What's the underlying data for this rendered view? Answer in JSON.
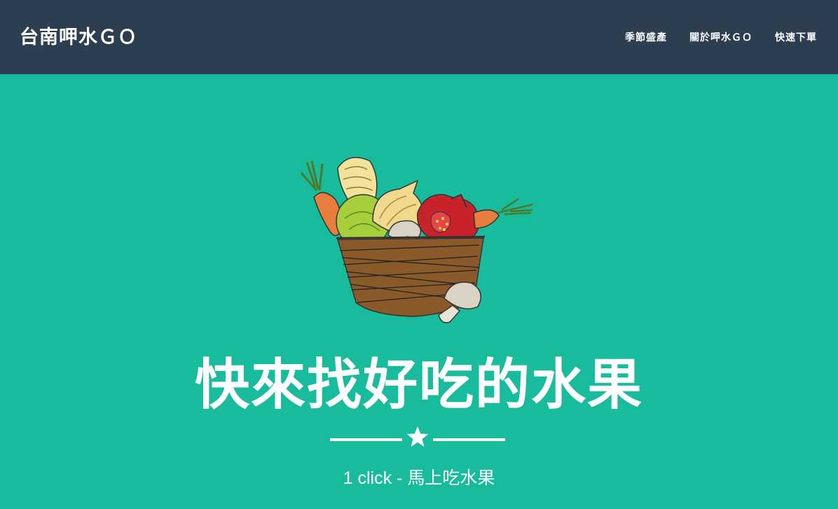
{
  "navbar": {
    "brand": "台南呷水ＧＯ",
    "links": [
      "季節盛產",
      "關於呷水ＧＯ",
      "快速下單"
    ],
    "bg_color": "#2c3e50"
  },
  "hero": {
    "image_icon": "vegetable-basket-icon",
    "headline": "快來找好吃的水果",
    "divider_icon": "star-icon",
    "subtitle": "1 click - 馬上吃水果",
    "bg_color": "#18bc9c"
  }
}
